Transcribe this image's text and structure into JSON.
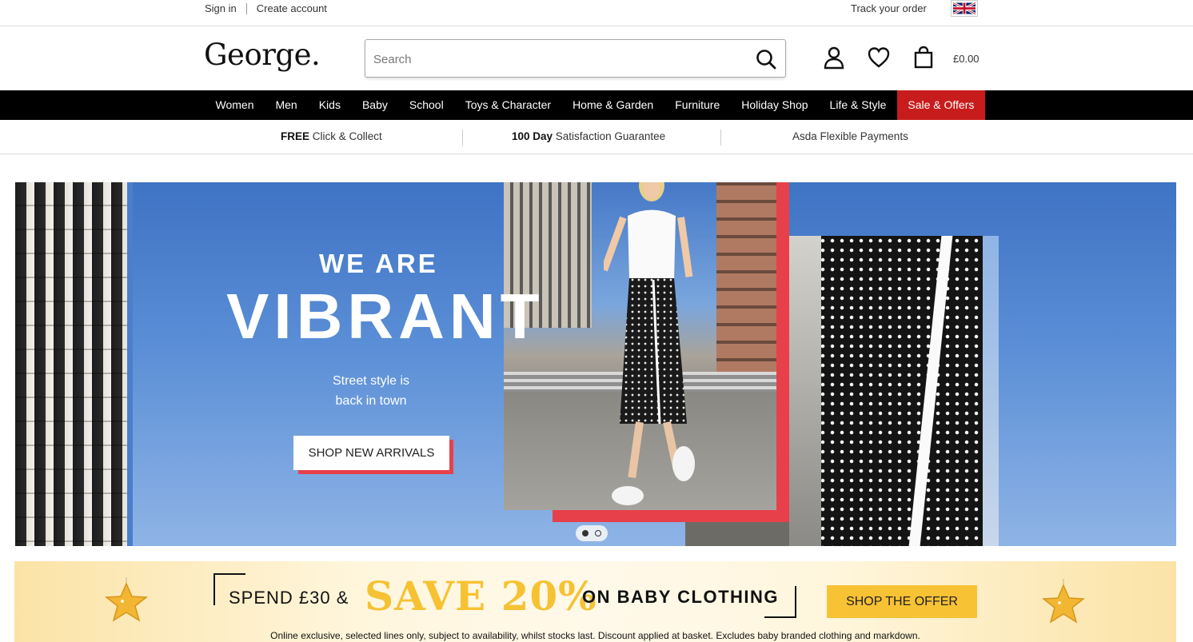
{
  "utility": {
    "sign_in": "Sign in",
    "create_account": "Create account",
    "track_order": "Track your order"
  },
  "header": {
    "logo": "George.",
    "search_placeholder": "Search",
    "basket_total": "£0.00"
  },
  "nav": {
    "items": [
      "Women",
      "Men",
      "Kids",
      "Baby",
      "School",
      "Toys & Character",
      "Home & Garden",
      "Furniture",
      "Holiday Shop",
      "Life & Style",
      "Sale & Offers"
    ]
  },
  "benefits": {
    "b1_strong": "FREE",
    "b1_rest": " Click & Collect",
    "b2_strong": "100 Day",
    "b2_rest": " Satisfaction Guarantee",
    "b3": "Asda Flexible Payments"
  },
  "hero": {
    "title_small": "WE ARE",
    "title_big": "VIBRANT",
    "subtitle_line1": "Street style is",
    "subtitle_line2": "back in town",
    "cta": "SHOP NEW ARRIVALS",
    "slide_count": 2,
    "active_slide": 1
  },
  "promo": {
    "spend": "SPEND £30 &",
    "save": "SAVE 20%",
    "on": "ON BABY CLOTHING",
    "cta": "SHOP THE OFFER",
    "small_print": "Online exclusive, selected lines only, subject to availability, whilst stocks last. Discount applied at basket. Excludes baby branded clothing and markdown."
  },
  "colors": {
    "nav_bg": "#000000",
    "sale_bg": "#c81c1c",
    "hero_accent": "#e8404a",
    "promo_yellow": "#f6c233"
  },
  "icons": [
    "uk-flag-icon",
    "search-icon",
    "account-icon",
    "heart-icon",
    "basket-icon",
    "star-icon"
  ]
}
